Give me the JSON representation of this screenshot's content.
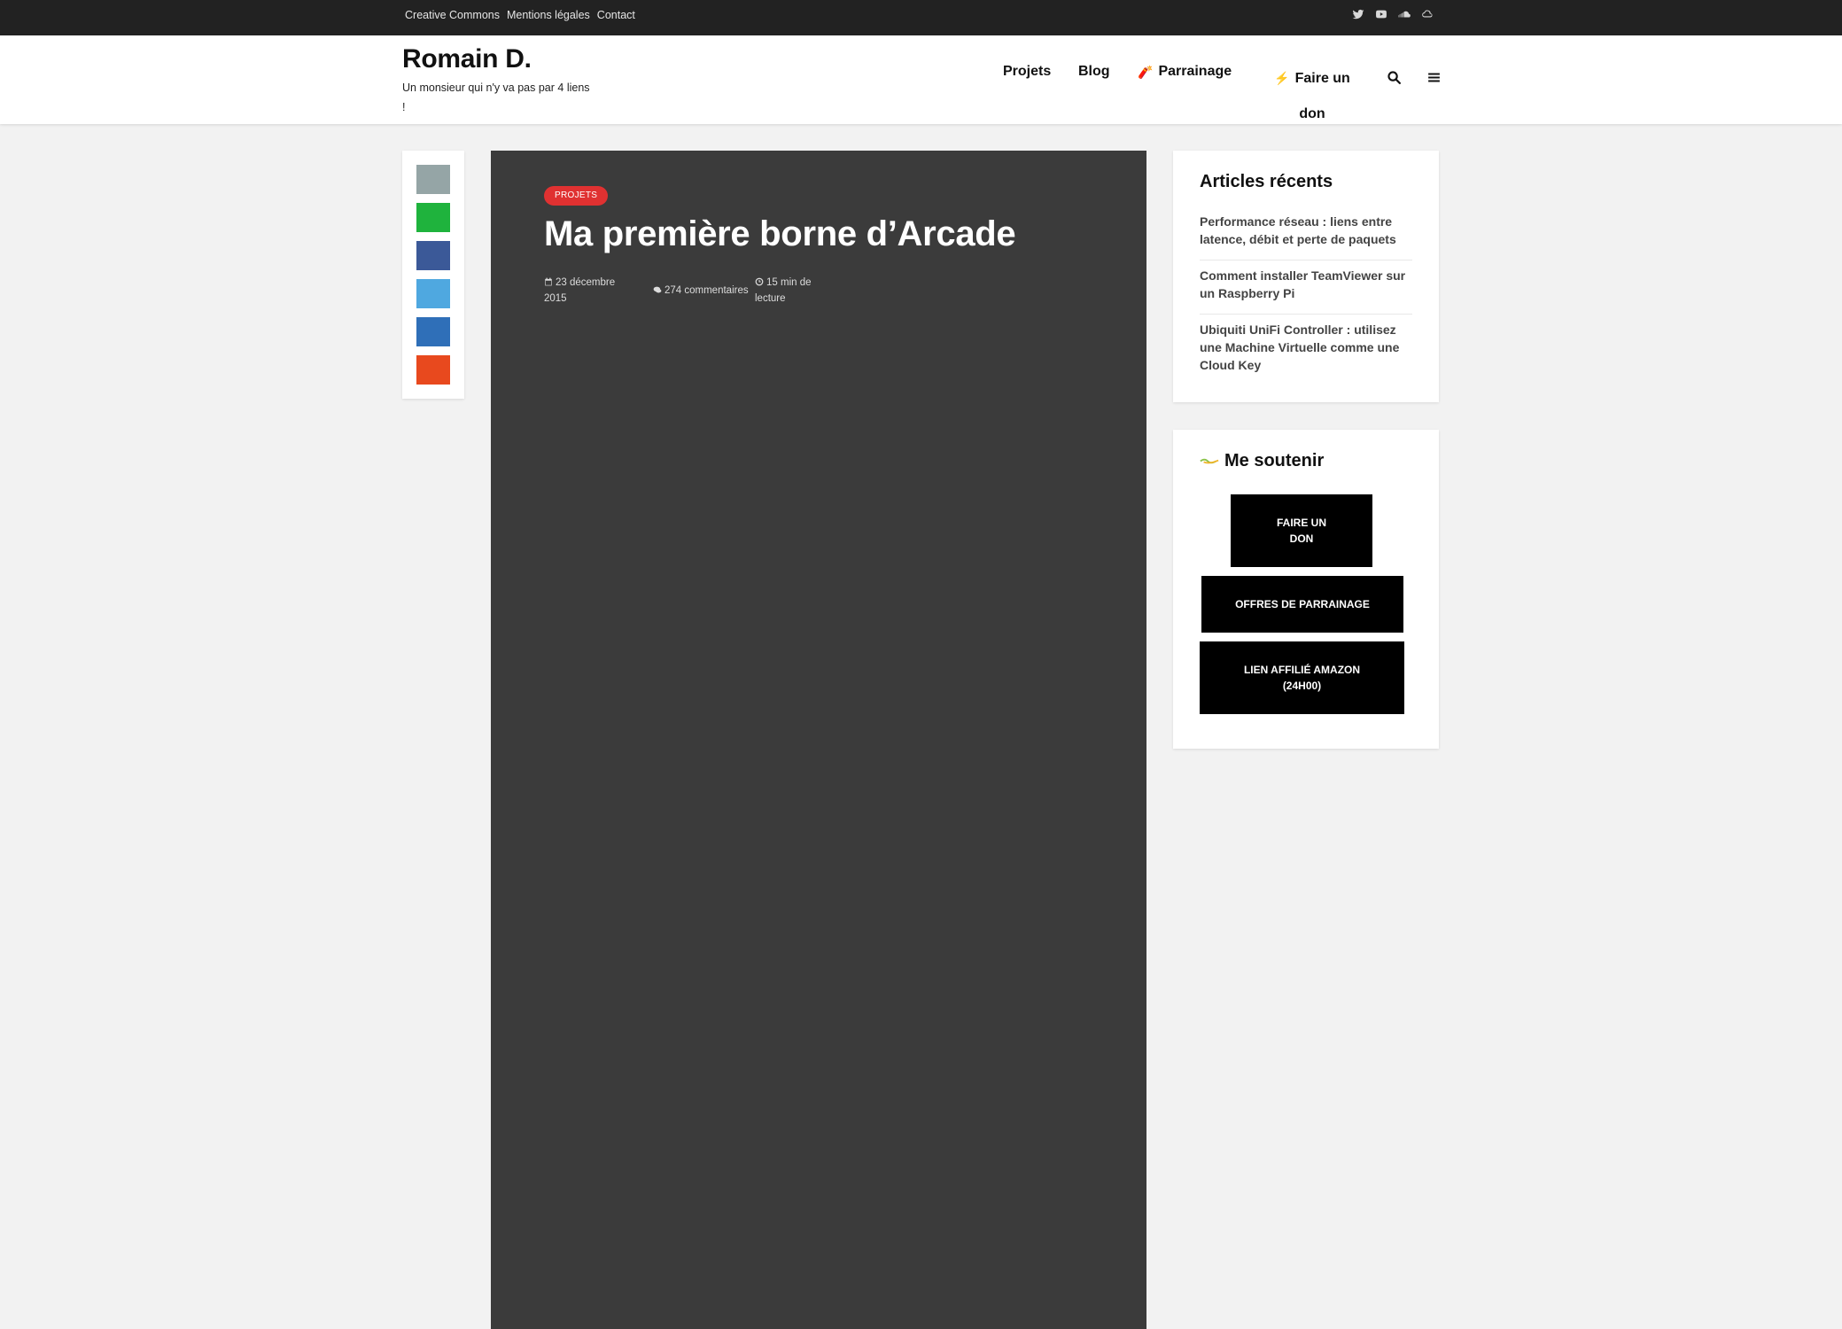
{
  "topbar": {
    "links": [
      "Creative Commons",
      "Mentions légales",
      "Contact"
    ],
    "social_icons": [
      "twitter-icon",
      "youtube-icon",
      "soundcloud-icon",
      "cloud-icon"
    ]
  },
  "header": {
    "site_title": "Romain D.",
    "tagline": "Un monsieur qui n'y va pas par 4 liens !",
    "nav": {
      "projets": "Projets",
      "blog": "Blog",
      "parrainage_emoji": "🧨",
      "parrainage": "Parrainage",
      "don_emoji": "⚡",
      "don": "Faire un don"
    },
    "icons": [
      "search-icon",
      "menu-icon"
    ]
  },
  "share": {
    "buttons": [
      {
        "name": "share-generic",
        "color": "#95a5a6"
      },
      {
        "name": "share-whatsapp",
        "color": "#1fb33d"
      },
      {
        "name": "share-facebook",
        "color": "#3b5998"
      },
      {
        "name": "share-twitter",
        "color": "#4fa8e0"
      },
      {
        "name": "share-linkedin",
        "color": "#2f6fb8"
      },
      {
        "name": "share-reddit",
        "color": "#e8491e"
      }
    ]
  },
  "article": {
    "category": "PROJETS",
    "title": "Ma première borne d’Arcade",
    "date": "23 décembre 2015",
    "comments": "274 commentaires",
    "reading_time": "15 min de lecture",
    "background": "#3b3b3b",
    "badge_color": "#e03131"
  },
  "sidebar": {
    "recent": {
      "title": "Articles récents",
      "items": [
        "Performance réseau : liens entre latence, débit et perte de paquets",
        "Comment installer TeamViewer sur un Raspberry Pi",
        "Ubiquiti UniFi Controller : utilisez une Machine Virtuelle comme une Cloud Key"
      ]
    },
    "support": {
      "title": "Me soutenir",
      "buttons": [
        "FAIRE UN DON",
        "OFFRES DE PARRAINAGE",
        "LIEN AFFILIÉ AMAZON (24H00)"
      ]
    }
  }
}
